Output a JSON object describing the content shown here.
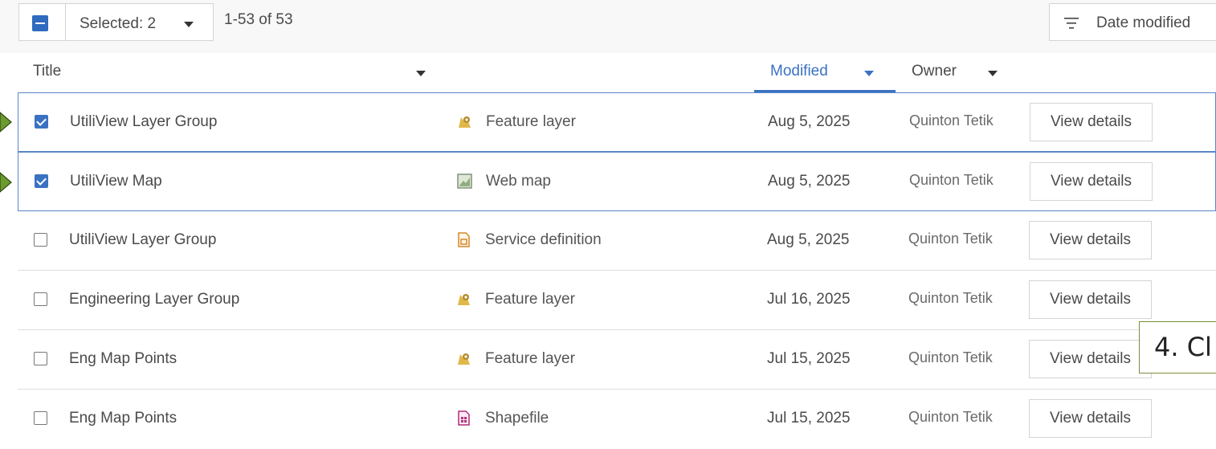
{
  "toolbar": {
    "selected_label": "Selected: 2",
    "count_label": "1-53 of 53",
    "sort_label": "Date modified"
  },
  "columns": {
    "title": "Title",
    "modified": "Modified",
    "owner": "Owner"
  },
  "rows": [
    {
      "title": "UtiliView Layer Group",
      "type": "Feature layer",
      "type_icon": "feature-layer-icon",
      "date": "Aug 5, 2025",
      "owner": "Quinton Tetik",
      "button": "View details",
      "checked": true
    },
    {
      "title": "UtiliView Map",
      "type": "Web map",
      "type_icon": "web-map-icon",
      "date": "Aug 5, 2025",
      "owner": "Quinton Tetik",
      "button": "View details",
      "checked": true
    },
    {
      "title": "UtiliView Layer Group",
      "type": "Service definition",
      "type_icon": "service-definition-icon",
      "date": "Aug 5, 2025",
      "owner": "Quinton Tetik",
      "button": "View details",
      "checked": false
    },
    {
      "title": "Engineering Layer Group",
      "type": "Feature layer",
      "type_icon": "feature-layer-icon",
      "date": "Jul 16, 2025",
      "owner": "Quinton Tetik",
      "button": "View details",
      "checked": false
    },
    {
      "title": "Eng Map Points",
      "type": "Feature layer",
      "type_icon": "feature-layer-icon",
      "date": "Jul 15, 2025",
      "owner": "Quinton Tetik",
      "button": "View details",
      "checked": false
    },
    {
      "title": "Eng Map Points",
      "type": "Shapefile",
      "type_icon": "shapefile-icon",
      "date": "Jul 15, 2025",
      "owner": "Quinton Tetik",
      "button": "View details",
      "checked": false
    }
  ],
  "callout": {
    "text": "4. Cl"
  },
  "colors": {
    "accent": "#3a72c2",
    "marker": "#6b9a2e"
  }
}
